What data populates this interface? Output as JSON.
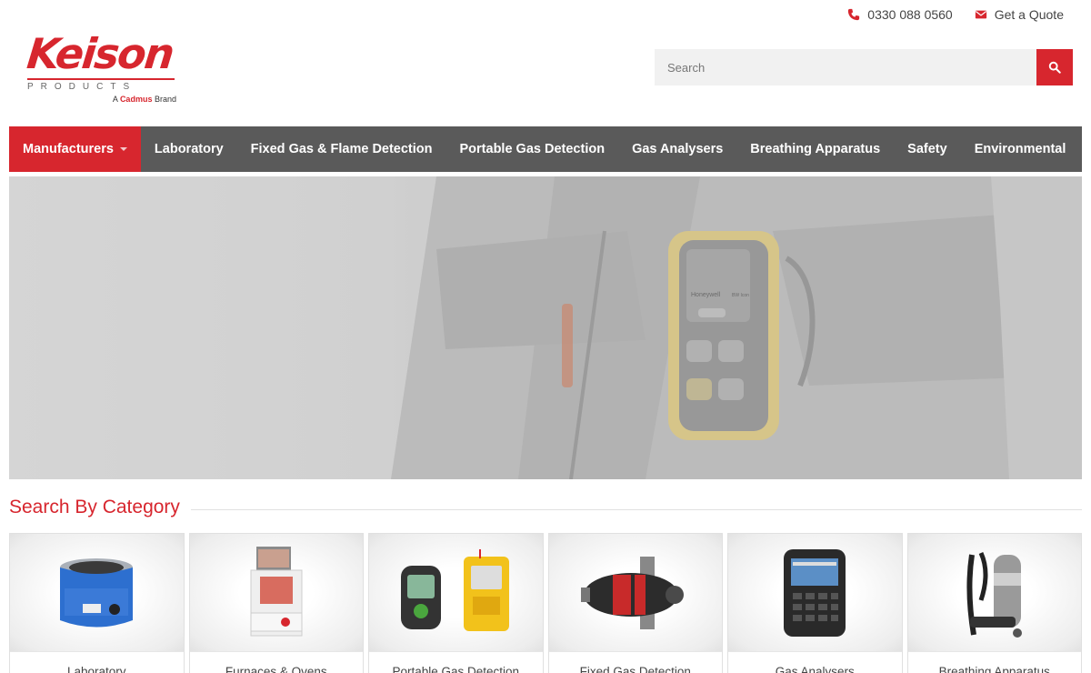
{
  "header": {
    "phone": "0330 088 0560",
    "quote": "Get a Quote",
    "logo": {
      "main": "Keison",
      "sub": "PRODUCTS",
      "brand_prefix": "A",
      "brand_name": "Cadmus",
      "brand_suffix": "Brand"
    },
    "search": {
      "placeholder": "Search"
    }
  },
  "nav": {
    "items": [
      {
        "label": "Manufacturers",
        "active": true,
        "dropdown": true
      },
      {
        "label": "Laboratory"
      },
      {
        "label": "Fixed Gas & Flame Detection"
      },
      {
        "label": "Portable Gas Detection"
      },
      {
        "label": "Gas Analysers"
      },
      {
        "label": "Breathing Apparatus"
      },
      {
        "label": "Safety"
      },
      {
        "label": "Environmental"
      }
    ]
  },
  "hero": {
    "device_brand": "Honeywell",
    "device_model": "BW Icon"
  },
  "categories": {
    "title": "Search By Category",
    "items": [
      {
        "label": "Laboratory"
      },
      {
        "label": "Furnaces & Ovens"
      },
      {
        "label": "Portable Gas Detection"
      },
      {
        "label": "Fixed Gas Detection"
      },
      {
        "label": "Gas Analysers"
      },
      {
        "label": "Breathing Apparatus"
      }
    ]
  },
  "colors": {
    "accent": "#d7262e",
    "nav_bg": "#5a5a5a",
    "search_bg": "#f1f1f1"
  }
}
